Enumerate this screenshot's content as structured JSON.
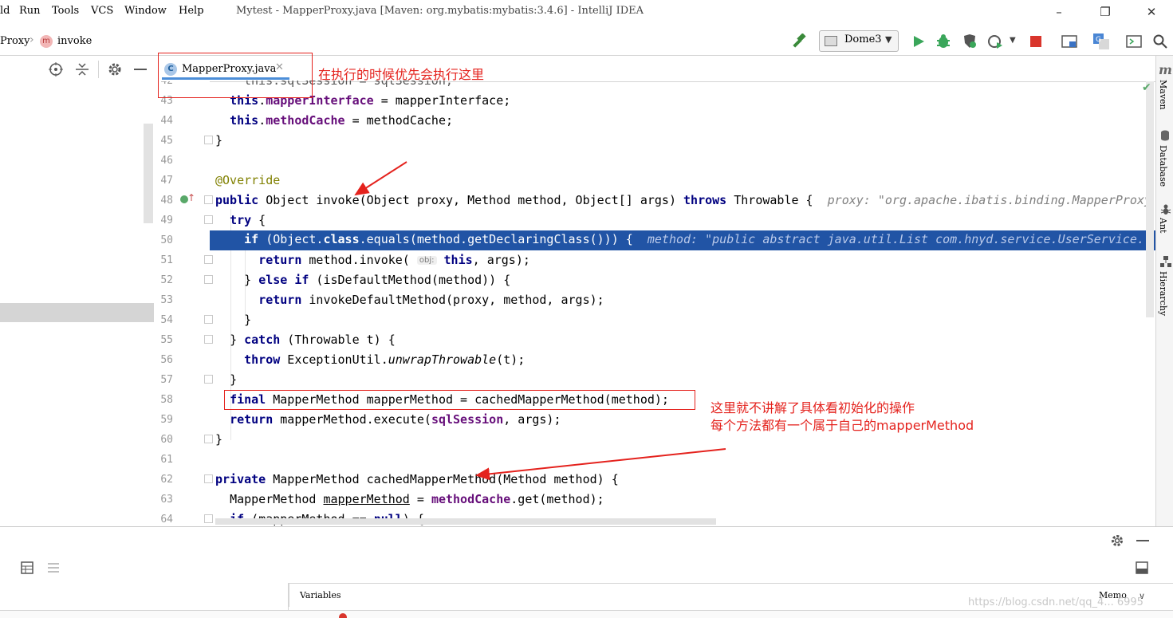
{
  "window": {
    "title": "Mytest - MapperProxy.java [Maven: org.mybatis:mybatis:3.4.6] - IntelliJ IDEA",
    "menu": [
      "ld",
      "Run",
      "Tools",
      "VCS",
      "Window",
      "Help"
    ],
    "controls": {
      "minimize": "–",
      "restore": "❐",
      "close": "✕"
    }
  },
  "navbar": {
    "breadcrumb_class": "Proxy",
    "breadcrumb_method": "invoke",
    "method_badge": "m",
    "run_config": "Dome3"
  },
  "editor": {
    "tab_label": "MapperProxy.java",
    "tab_icon": "C",
    "line_numbers": [
      "42",
      "43",
      "44",
      "45",
      "46",
      "47",
      "48",
      "49",
      "50",
      "51",
      "52",
      "53",
      "54",
      "55",
      "56",
      "57",
      "58",
      "59",
      "60",
      "61",
      "62",
      "63",
      "64"
    ],
    "lines": {
      "l42": "this.sqlSession = sqlSession;",
      "l43_kw": "this",
      "l43_field": "mapperInterface",
      "l43_rest": " = mapperInterface;",
      "l44_kw": "this",
      "l44_field": "methodCache",
      "l44_rest": " = methodCache;",
      "l45": "}",
      "l47": "@Override",
      "l48_kw": "public",
      "l48_mid": " Object invoke(Object proxy, Method method, Object[] args) ",
      "l48_kw2": "throws",
      "l48_rest": " Throwable {",
      "l48_hint": "proxy: \"org.apache.ibatis.binding.MapperProxy",
      "l49_kw": "try",
      "l49_rest": " {",
      "l50_kw": "if",
      "l50_mid": " (Object.",
      "l50_kw2": "class",
      "l50_rest": ".equals(method.getDeclaringClass())) {",
      "l50_hint": "method: \"public abstract java.util.List com.hnyd.service.UserService.",
      "l51_kw": "return",
      "l51_mid": " method.invoke(",
      "l51_obj": "obj:",
      "l51_kw2": "this",
      "l51_rest": ", args);",
      "l52_pre": "} ",
      "l52_kw": "else if",
      "l52_rest": " (isDefaultMethod(method)) {",
      "l53_kw": "return",
      "l53_rest": " invokeDefaultMethod(proxy, method, args);",
      "l54": "}",
      "l55_pre": "} ",
      "l55_kw": "catch",
      "l55_rest": " (Throwable t) {",
      "l56_kw": "throw",
      "l56_mid": " ExceptionUtil.",
      "l56_it": "unwrapThrowable",
      "l56_rest": "(t);",
      "l57": "}",
      "l58_kw": "final",
      "l58_rest": " MapperMethod mapperMethod = cachedMapperMethod(method);",
      "l59_kw": "return",
      "l59_mid": " mapperMethod.execute(",
      "l59_field": "sqlSession",
      "l59_rest": ", args);",
      "l60": "}",
      "l62_kw": "private",
      "l62_rest": " MapperMethod cachedMapperMethod(Method method) {",
      "l63_pre": "MapperMethod ",
      "l63_u": "mapperMethod",
      "l63_mid": " = ",
      "l63_field": "methodCache",
      "l63_rest": ".get(method);",
      "l64_kw": "if",
      "l64_mid": " (",
      "l64_u": "mapperMethod",
      "l64_mid2": " == ",
      "l64_kw2": "null",
      "l64_rest": ") {"
    }
  },
  "annotations": {
    "tab_note": "在执行的时候优先会执行这里",
    "line58_note_1": "这里就不讲解了具体看初始化的操作",
    "line58_note_2": "每个方法都有一个属于自己的mapperMethod",
    "color": "#e4221d"
  },
  "right_tools": [
    "Maven",
    "Database",
    "Ant",
    "Hierarchy"
  ],
  "debug": {
    "variables_label": "Variables",
    "memory_label": "Memo",
    "watermark": "https://blog.csdn.net/qq_4... 6995"
  },
  "colors": {
    "execution_line": "#2154a5",
    "keyword": "#000080",
    "field": "#660e7a",
    "annotation": "#808000"
  }
}
